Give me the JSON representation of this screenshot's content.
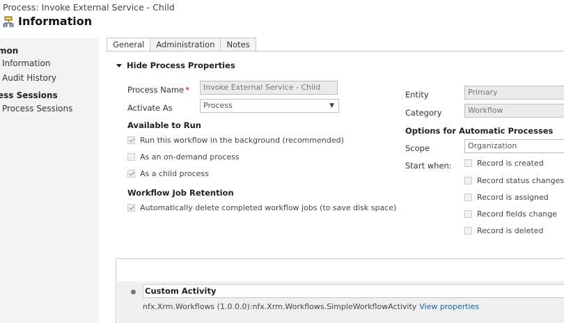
{
  "header": {
    "breadcrumb": "Process: Invoke External Service - Child",
    "title": "Information",
    "icon": "process-icon"
  },
  "sidebar": {
    "group1": "mon",
    "items1": [
      "Information",
      "Audit History"
    ],
    "group2": "ess Sessions",
    "items2": [
      "Process Sessions"
    ]
  },
  "tabs": [
    "General",
    "Administration",
    "Notes"
  ],
  "section": {
    "label": "Hide Process Properties"
  },
  "form": {
    "process_name_label": "Process Name",
    "required_marker": "*",
    "process_name_value": "Invoke External Service - Child",
    "activate_as_label": "Activate As",
    "activate_as_value": "Process",
    "available_heading": "Available to Run",
    "available_options": [
      {
        "label": "Run this workflow in the background (recommended)",
        "checked": true
      },
      {
        "label": "As an on-demand process",
        "checked": false
      },
      {
        "label": "As a child process",
        "checked": true
      }
    ],
    "retention_heading": "Workflow Job Retention",
    "retention_option": {
      "label": "Automatically delete completed workflow jobs (to save disk space)",
      "checked": true
    }
  },
  "right": {
    "entity_label": "Entity",
    "entity_value": "Primary",
    "category_label": "Category",
    "category_value": "Workflow",
    "options_heading": "Options for Automatic Processes",
    "scope_label": "Scope",
    "scope_value": "Organization",
    "start_when_label": "Start when:",
    "start_options": [
      {
        "label": "Record is created",
        "checked": false
      },
      {
        "label": "Record status changes",
        "checked": false
      },
      {
        "label": "Record is assigned",
        "checked": false
      },
      {
        "label": "Record fields change",
        "checked": false
      },
      {
        "label": "Record is deleted",
        "checked": false
      }
    ]
  },
  "designer": {
    "step_title": "Custom Activity",
    "step_desc": "nfx.Xrm.Workflows (1.0.0.0):nfx.Xrm.Workflows.SimpleWorkflowActivity",
    "step_link": "View properties"
  },
  "colors": {
    "accent_link": "#1160b7",
    "required": "#c00000",
    "sidebar_bg": "#f3f3f3"
  }
}
